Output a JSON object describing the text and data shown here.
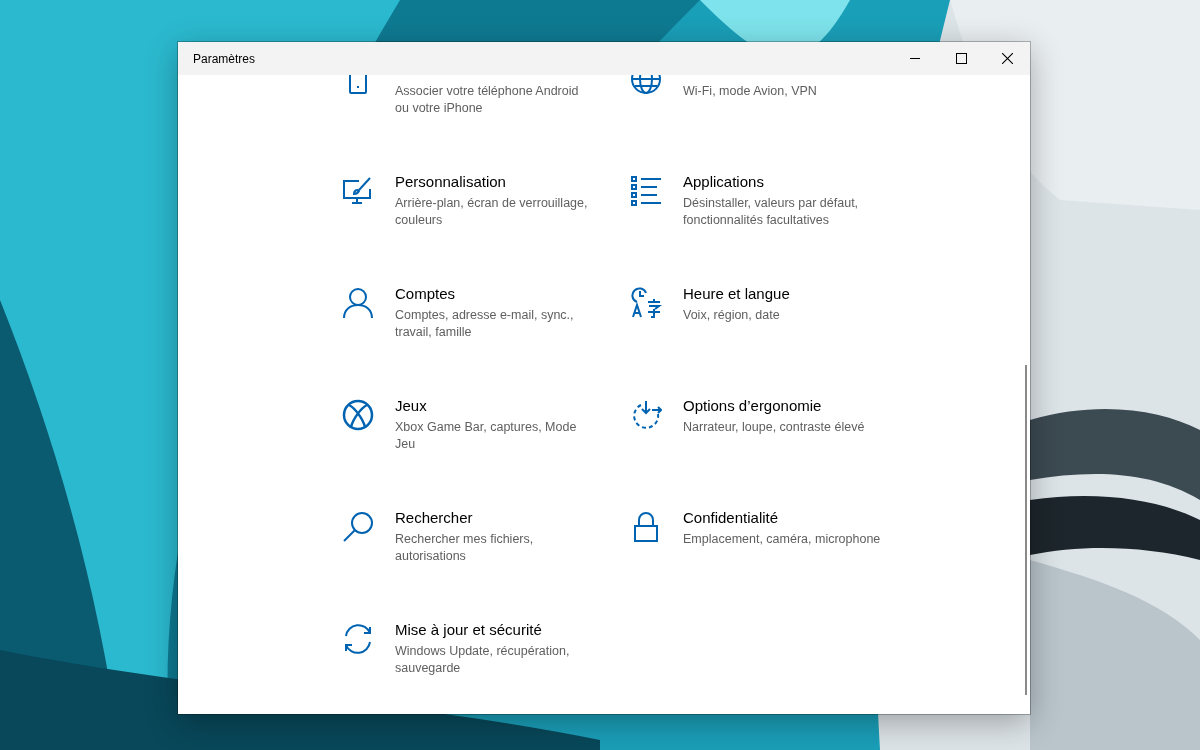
{
  "window": {
    "title": "Paramètres"
  },
  "categories": [
    {
      "description": "Associer votre téléphone Android ou votre iPhone"
    },
    {
      "description": "Wi-Fi, mode Avion, VPN"
    },
    {
      "title": "Personnalisation",
      "description": "Arrière-plan, écran de verrouillage, couleurs"
    },
    {
      "title": "Applications",
      "description": "Désinstaller, valeurs par défaut, fonctionnalités facultatives"
    },
    {
      "title": "Comptes",
      "description": "Comptes, adresse e-mail, sync., travail, famille"
    },
    {
      "title": "Heure et langue",
      "description": "Voix, région, date"
    },
    {
      "title": "Jeux",
      "description": "Xbox Game Bar, captures, Mode Jeu"
    },
    {
      "title": "Options d’ergonomie",
      "description": "Narrateur, loupe, contraste élevé"
    },
    {
      "title": "Rechercher",
      "description": "Rechercher mes fichiers, autorisations"
    },
    {
      "title": "Confidentialité",
      "description": "Emplacement, caméra, microphone"
    },
    {
      "title": "Mise à jour et sécurité",
      "description": "Windows Update, récupération, sauvegarde"
    }
  ]
}
